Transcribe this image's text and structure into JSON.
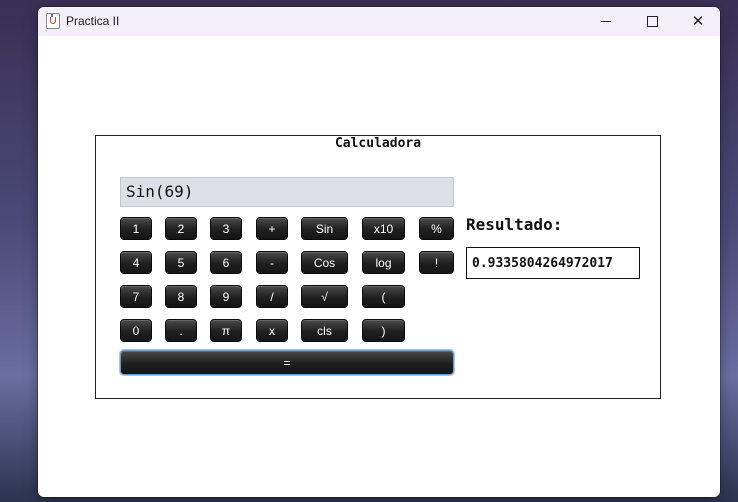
{
  "window": {
    "title": "Practica II",
    "controls": {
      "minimize": "–",
      "maximize": "□",
      "close": "✕"
    }
  },
  "calculator": {
    "panel_title": "Calculadora",
    "display_value": "Sin(69)",
    "result_label": "Resultado:",
    "result_value": "0.9335804264972017",
    "buttons": {
      "one": "1",
      "two": "2",
      "three": "3",
      "plus": "+",
      "sin": "Sin",
      "x10": "x10",
      "percent": "%",
      "four": "4",
      "five": "5",
      "six": "6",
      "minus": "-",
      "cos": "Cos",
      "log": "log",
      "factorial": "!",
      "seven": "7",
      "eight": "8",
      "nine": "9",
      "divide": "/",
      "sqrt": "√",
      "open_paren": "(",
      "zero": "0",
      "dot": ".",
      "pi": "π",
      "multiply": "x",
      "cls": "cls",
      "close_paren": ")",
      "equals": "="
    }
  }
}
